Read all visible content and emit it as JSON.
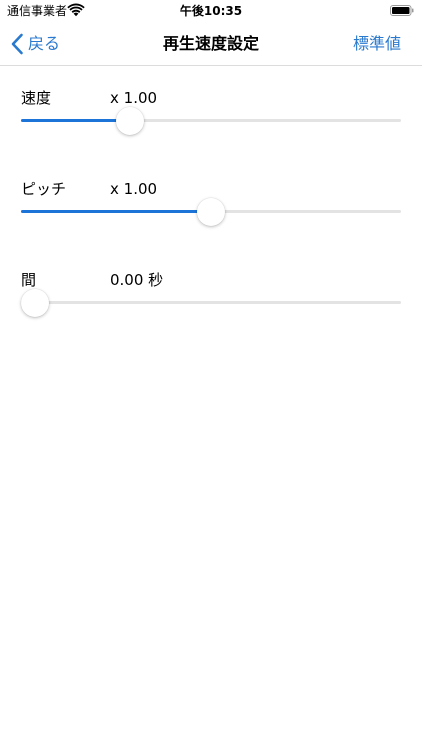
{
  "status_bar": {
    "carrier": "通信事業者",
    "time": "午後10:35",
    "wifi_icon": "wifi-icon",
    "battery_icon": "battery-icon"
  },
  "nav": {
    "back_label": "戻る",
    "back_icon": "chevron-left-icon",
    "title": "再生速度設定",
    "reset_label": "標準値"
  },
  "colors": {
    "accent": "#2979cf",
    "slider_fill": "#1d74d8",
    "slider_track": "#e3e3e3"
  },
  "settings": [
    {
      "label": "速度",
      "value": "x 1.00",
      "position_fraction": 0.27
    },
    {
      "label": "ピッチ",
      "value": "x 1.00",
      "position_fraction": 0.5
    },
    {
      "label": "間",
      "value": "0.00 秒",
      "position_fraction": 0.0
    }
  ]
}
